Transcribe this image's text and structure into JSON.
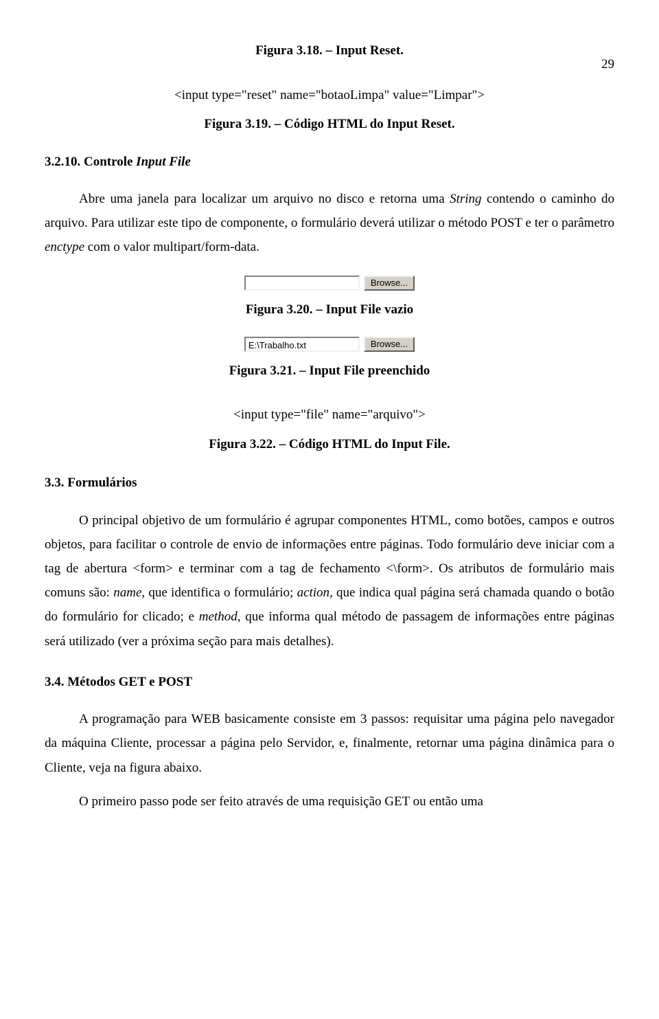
{
  "page_number": "29",
  "captions": {
    "fig318": "Figura 3.18. – Input Reset.",
    "code_reset": "<input type=\"reset\" name=\"botaoLimpa\" value=\"Limpar\">",
    "fig319": "Figura 3.19. – Código HTML do Input Reset.",
    "fig320": "Figura 3.20. – Input File vazio",
    "fig321": "Figura 3.21. – Input File preenchido",
    "code_file": "<input type=\"file\" name=\"arquivo\">",
    "fig322": "Figura 3.22. – Código HTML do Input File."
  },
  "sections": {
    "s3210_a": "3.2.10. Controle ",
    "s3210_b": "Input File",
    "s33": "3.3. Formulários",
    "s34": "3.4. Métodos GET e POST"
  },
  "file_widgets": {
    "empty_value": "",
    "filled_value": "E:\\Trabalho.txt",
    "browse_label": "Browse..."
  },
  "paragraphs": {
    "p_input_file_a": "Abre uma janela para localizar um arquivo no disco e retorna uma ",
    "p_input_file_string": "String",
    "p_input_file_b": " contendo o caminho do arquivo. Para utilizar este tipo de componente, o formulário deverá utilizar o método POST e ter o parâmetro ",
    "p_input_file_enctype": "enctype",
    "p_input_file_c": " com o valor multipart/form-data.",
    "p_forms_a": "O principal objetivo de um formulário é agrupar componentes HTML, como botões, campos e outros objetos, para facilitar o controle de envio de informações entre páginas. Todo formulário deve iniciar com a tag de abertura <form> e terminar com a tag de fechamento <\\form>. Os atributos de formulário mais comuns são: ",
    "p_forms_name": "name",
    "p_forms_b": ", que identifica o formulário; ",
    "p_forms_action": "action",
    "p_forms_c": ", que indica qual página será chamada quando o botão do formulário for clicado; e ",
    "p_forms_method": "method",
    "p_forms_d": ", que informa qual método de passagem de informações entre páginas será utilizado (ver a próxima seção para mais detalhes).",
    "p_getpost_1": "A programação para WEB basicamente consiste em 3 passos: requisitar uma página pelo navegador da máquina Cliente, processar a página pelo Servidor, e, finalmente, retornar uma página dinâmica para o Cliente, veja na figura abaixo.",
    "p_getpost_2": "O primeiro passo pode ser feito através de uma requisição GET ou então uma"
  }
}
